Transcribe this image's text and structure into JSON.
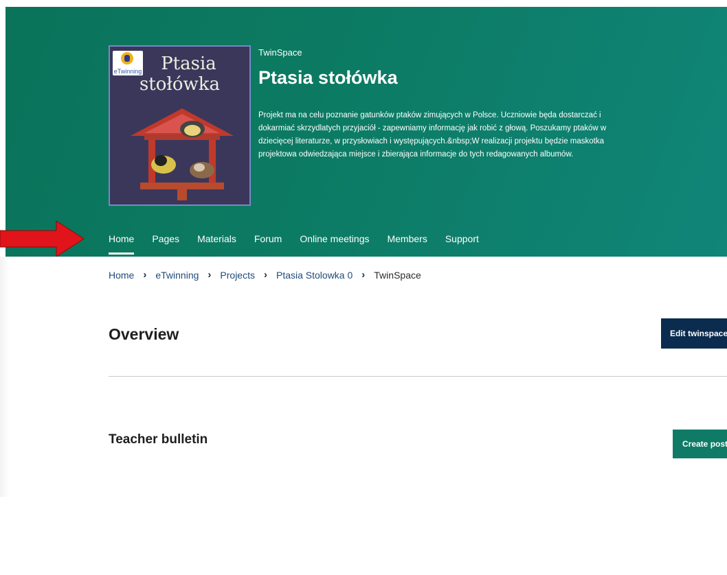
{
  "header": {
    "logo": {
      "badge_text": "eTwinning",
      "title_line1": "Ptasia",
      "title_line2": "stołówka"
    },
    "eyebrow": "TwinSpace",
    "title": "Ptasia stołówka",
    "description": "Projekt ma na celu poznanie gatunków ptaków zimujących w Polsce. Uczniowie będa dostarczać i dokarmiać skrzydlatych przyjaciół - zapewniamy informację jak robić z głową. Poszukamy ptaków w dziecięcej literaturze, w przysłowiach i występujących.&nbsp;W realizacji projektu będzie maskotka projektowa odwiedzająca miejsce i zbierająca informacje do tych redagowanych albumów."
  },
  "nav": {
    "items": [
      {
        "label": "Home",
        "active": true
      },
      {
        "label": "Pages"
      },
      {
        "label": "Materials"
      },
      {
        "label": "Forum"
      },
      {
        "label": "Online meetings"
      },
      {
        "label": "Members"
      },
      {
        "label": "Support"
      }
    ]
  },
  "breadcrumb": {
    "items": [
      "Home",
      "eTwinning",
      "Projects",
      "Ptasia Stolowka 0",
      "TwinSpace"
    ],
    "separator": "›"
  },
  "overview": {
    "title": "Overview",
    "edit_button": "Edit twinspace"
  },
  "bulletin": {
    "title": "Teacher bulletin",
    "create_button": "Create post"
  },
  "colors": {
    "hero": "#0c7a62",
    "nav_dark": "#0b2c4f",
    "create_btn": "#0f7b67",
    "arrow": "#e0141a"
  }
}
